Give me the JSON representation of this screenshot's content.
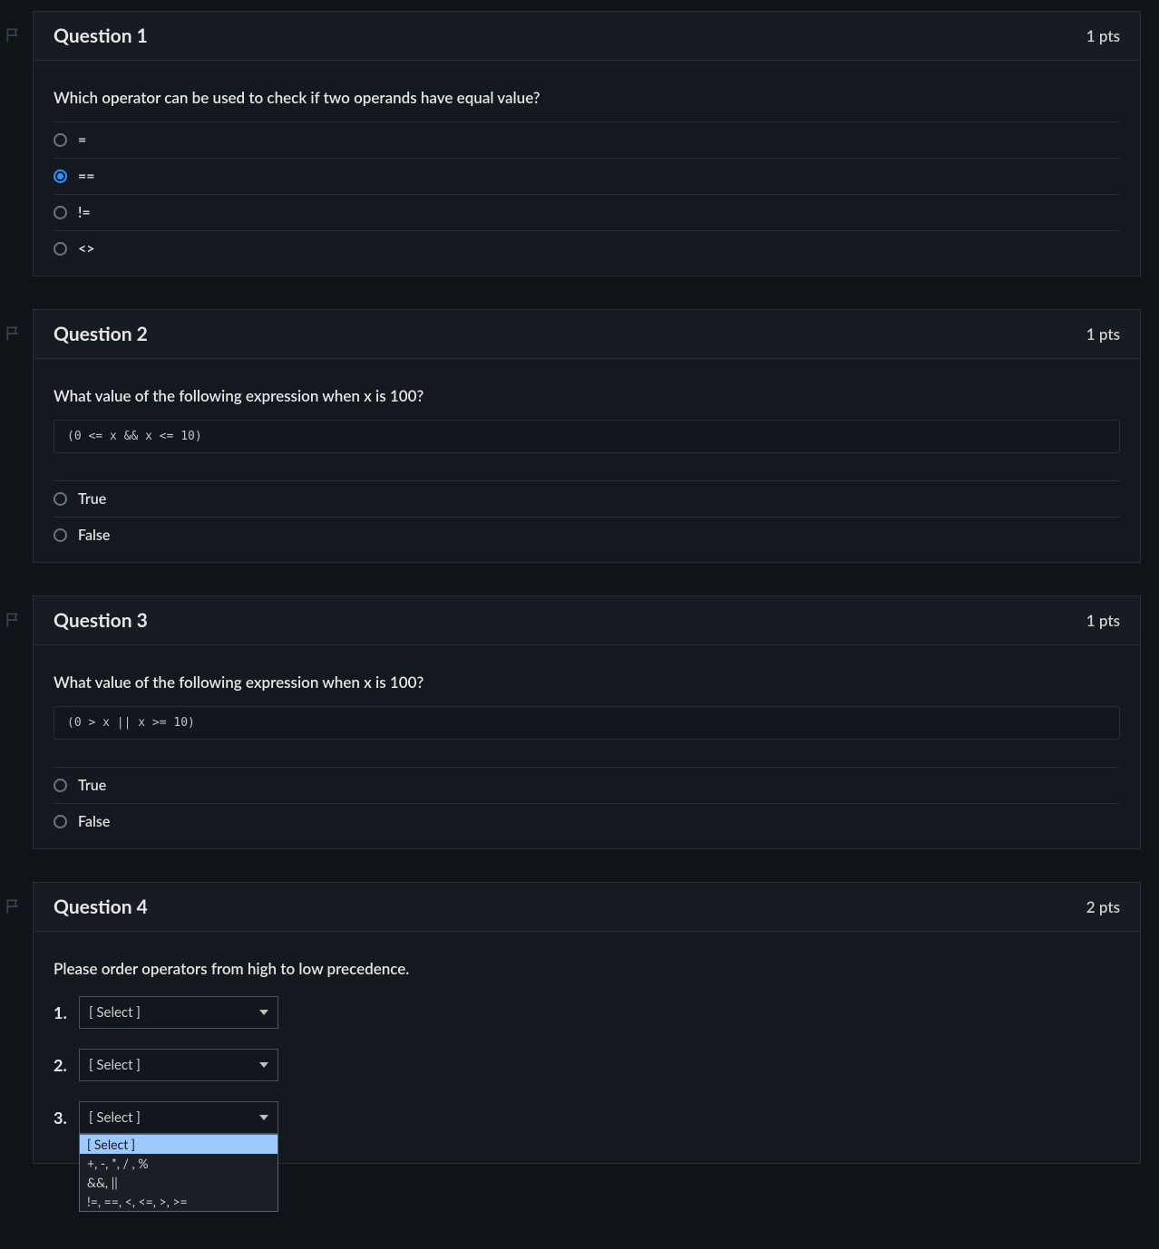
{
  "questions": [
    {
      "title": "Question 1",
      "pts": "1 pts",
      "prompt": "Which operator can be used to check if two operands have equal value?",
      "code": null,
      "answers": [
        {
          "label": "=",
          "checked": false
        },
        {
          "label": "==",
          "checked": true
        },
        {
          "label": "!=",
          "checked": false
        },
        {
          "label": "<>",
          "checked": false
        }
      ]
    },
    {
      "title": "Question 2",
      "pts": "1 pts",
      "prompt": "What value of the following expression when x is 100?",
      "code": "(0 <= x && x <= 10)",
      "answers": [
        {
          "label": "True",
          "checked": false
        },
        {
          "label": "False",
          "checked": false
        }
      ]
    },
    {
      "title": "Question 3",
      "pts": "1 pts",
      "prompt": "What value of the following expression when x is 100?",
      "code": "(0 > x || x >= 10)",
      "answers": [
        {
          "label": "True",
          "checked": false
        },
        {
          "label": "False",
          "checked": false
        }
      ]
    }
  ],
  "q4": {
    "title": "Question 4",
    "pts": "2 pts",
    "prompt": "Please order operators from high to low precedence.",
    "rows": [
      {
        "num": "1.",
        "value": "[ Select ]"
      },
      {
        "num": "2.",
        "value": "[ Select ]"
      },
      {
        "num": "3.",
        "value": "[ Select ]"
      }
    ],
    "dropdown_open_index": 2,
    "dropdown_options": [
      {
        "label": "[ Select ]",
        "highlight": true
      },
      {
        "label": "+, -, *, / , %",
        "highlight": false
      },
      {
        "label": "&&, ||",
        "highlight": false
      },
      {
        "label": "!=, ==, <, <=, >, >=",
        "highlight": false
      }
    ]
  }
}
